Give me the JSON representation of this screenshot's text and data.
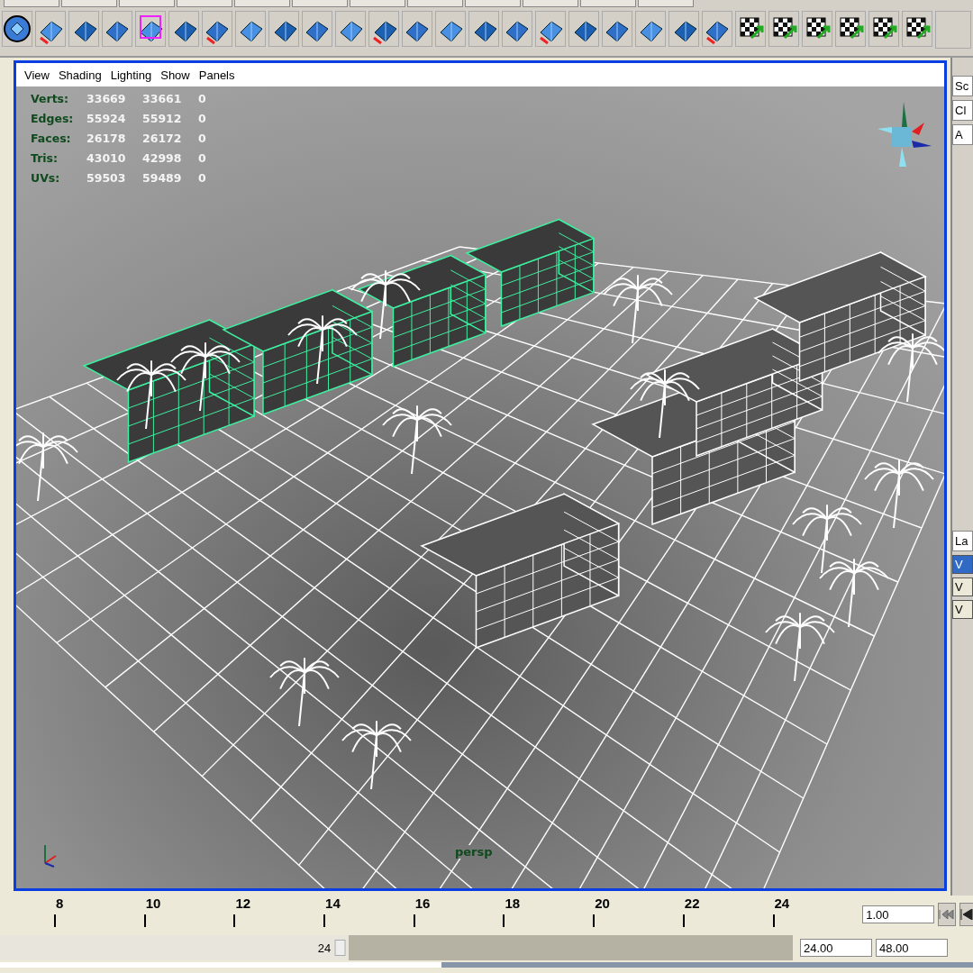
{
  "viewport": {
    "menu": [
      "View",
      "Shading",
      "Lighting",
      "Show",
      "Panels"
    ],
    "stats": [
      {
        "label": "Verts:",
        "total": "33669",
        "selected": "33661",
        "extra": "0"
      },
      {
        "label": "Edges:",
        "total": "55924",
        "selected": "55912",
        "extra": "0"
      },
      {
        "label": "Faces:",
        "total": "26178",
        "selected": "26172",
        "extra": "0"
      },
      {
        "label": "Tris:",
        "total": "43010",
        "selected": "42998",
        "extra": "0"
      },
      {
        "label": "UVs:",
        "total": "59503",
        "selected": "59489",
        "extra": "0"
      }
    ],
    "camera_label": "persp"
  },
  "side_panel": {
    "texts": [
      "Sc",
      "Cl",
      "A",
      "La"
    ],
    "layer_rows": [
      {
        "label": "V",
        "selected": true
      },
      {
        "label": "V",
        "selected": false
      },
      {
        "label": "V",
        "selected": false
      }
    ]
  },
  "time_slider": {
    "ticks": [
      "8",
      "10",
      "12",
      "14",
      "16",
      "18",
      "20",
      "22",
      "24"
    ],
    "current_time": "1.00"
  },
  "range_slider": {
    "level": 0.44,
    "range_end_label": "24",
    "start": "24.00",
    "end": "48.00"
  }
}
